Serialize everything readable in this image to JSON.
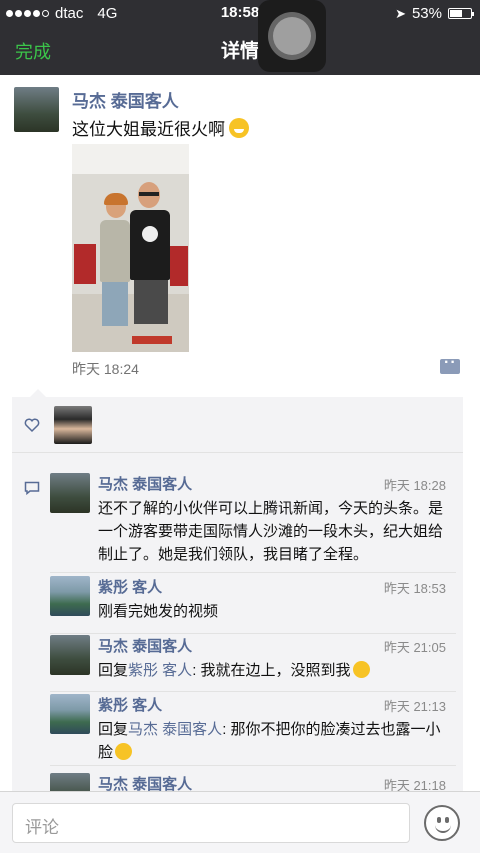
{
  "status_bar": {
    "carrier": "dtac",
    "network": "4G",
    "time": "18:58",
    "battery": "53%"
  },
  "nav": {
    "done_label": "完成",
    "title": "详情"
  },
  "post": {
    "author": "马杰 泰国客人",
    "text": "这位大姐最近很火啊",
    "time": "昨天 18:24"
  },
  "comments": [
    {
      "author": "马杰 泰国客人",
      "time": "昨天 18:28",
      "text": "还不了解的小伙伴可以上腾讯新闻，今天的头条。是一个游客要带走国际情人沙滩的一段木头，纪大姐给制止了。她是我们领队，我目睹了全程。"
    },
    {
      "author": "紫彤 客人",
      "time": "昨天 18:53",
      "text": "刚看完她发的视频"
    },
    {
      "author": "马杰 泰国客人",
      "time": "昨天 21:05",
      "reply_prefix": "回复",
      "reply_to": "紫彤 客人",
      "text": ": 我就在边上，没照到我"
    },
    {
      "author": "紫彤 客人",
      "time": "昨天 21:13",
      "reply_prefix": "回复",
      "reply_to": "马杰 泰国客人",
      "text": ": 那你不把你的脸凑过去也露一小脸"
    },
    {
      "author": "马杰 泰国客人",
      "time": "昨天 21:18",
      "text": ""
    }
  ],
  "input": {
    "placeholder": "评论"
  },
  "colors": {
    "nav_bg": "#2f2f33",
    "done_green": "#3bc44a",
    "name_blue": "#576b95",
    "box_bg": "#f3f3f5"
  }
}
